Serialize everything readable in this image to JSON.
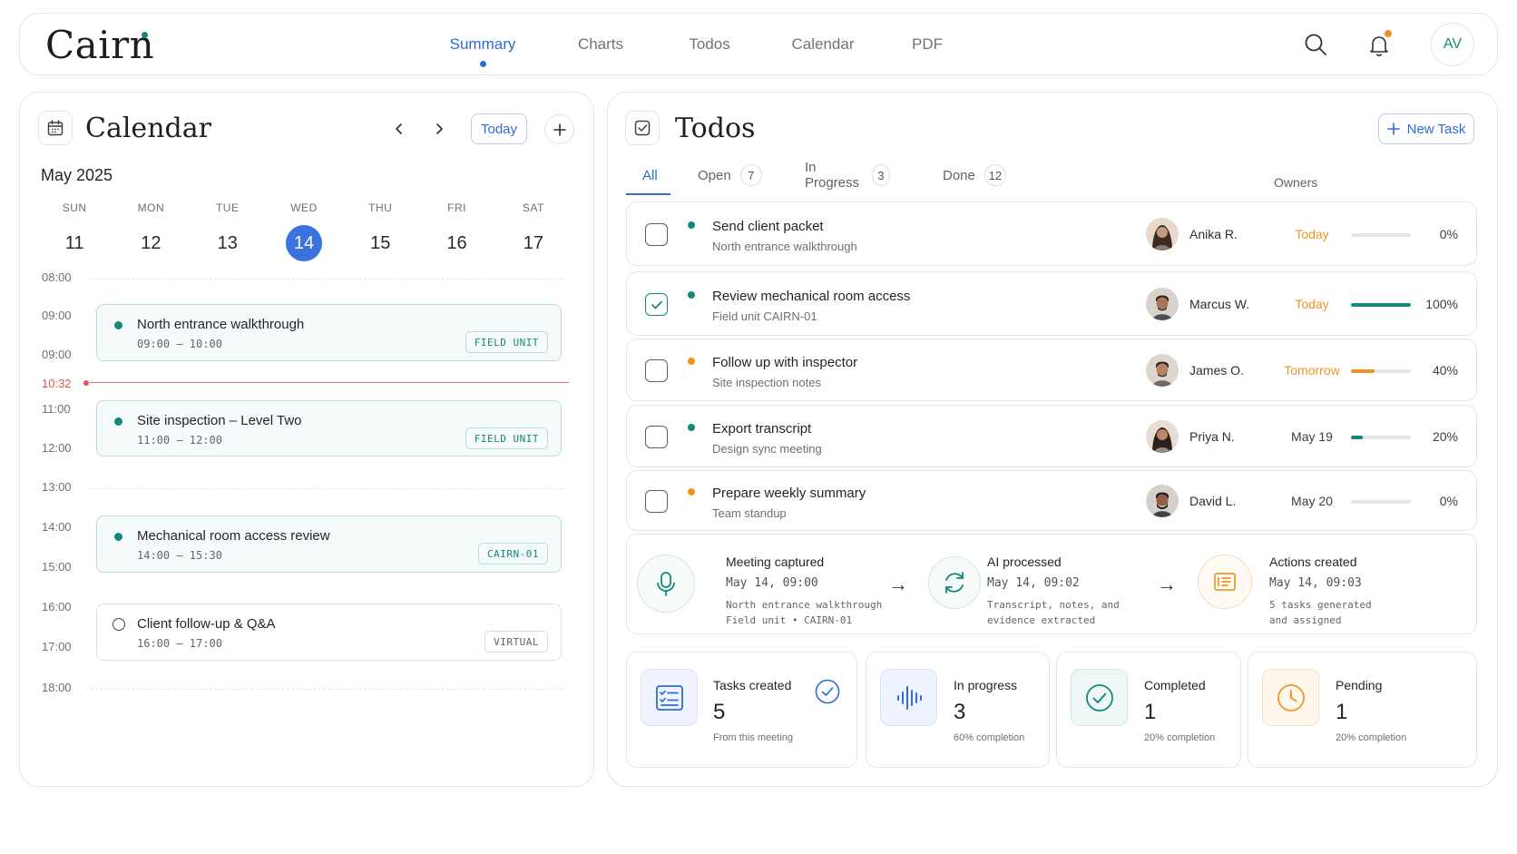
{
  "app": {
    "name": "Cairn"
  },
  "nav": {
    "items": [
      "Summary",
      "Charts",
      "Todos",
      "Calendar",
      "PDF"
    ],
    "active": "Summary"
  },
  "user": {
    "initials": "AV"
  },
  "icons": {
    "search": "search-icon",
    "bell": "bell-icon",
    "calendar": "calendar-icon",
    "todos": "checkbox-icon"
  },
  "calendar": {
    "title": "Calendar",
    "today_label": "Today",
    "month": "May 2025",
    "days": [
      {
        "name": "SUN",
        "num": "11"
      },
      {
        "name": "MON",
        "num": "12"
      },
      {
        "name": "TUE",
        "num": "13"
      },
      {
        "name": "WED",
        "num": "14",
        "selected": true
      },
      {
        "name": "THU",
        "num": "15"
      },
      {
        "name": "FRI",
        "num": "16"
      },
      {
        "name": "SAT",
        "num": "17"
      }
    ],
    "times": [
      "08:00",
      "09:00",
      "09:00",
      "11:00",
      "12:00",
      "13:00",
      "14:00",
      "15:00",
      "16:00",
      "17:00",
      "18:00"
    ],
    "now": "10:32",
    "events": [
      {
        "title": "North entrance walkthrough",
        "time": "09:00 – 10:00",
        "tag": "FIELD UNIT"
      },
      {
        "title": "Site inspection – Level Two",
        "time": "11:00 – 12:00",
        "tag": "FIELD UNIT"
      },
      {
        "title": "Mechanical room access review",
        "time": "14:00 – 15:30",
        "tag": "CAIRN-01"
      },
      {
        "title": "Client follow-up & Q&A",
        "time": "16:00 – 17:00",
        "tag": "VIRTUAL"
      }
    ]
  },
  "todos": {
    "title": "Todos",
    "new_task_label": "New Task",
    "tabs": [
      {
        "label": "All",
        "count": ""
      },
      {
        "label": "Open",
        "count": "7"
      },
      {
        "label": "In Progress",
        "count": "3"
      },
      {
        "label": "Done",
        "count": "12"
      }
    ],
    "owners_label": "Owners",
    "items": [
      {
        "title": "Send client packet",
        "subtitle": "North entrance walkthrough",
        "owner": "Anika R.",
        "due": "Today",
        "progress": "0%",
        "progress_value": 0,
        "checked": false,
        "priority_color": "#13897a",
        "due_color": "#ef9528",
        "bar_color": "#13897a"
      },
      {
        "title": "Review mechanical room access",
        "subtitle": "Field unit CAIRN-01",
        "owner": "Marcus W.",
        "due": "Today",
        "progress": "100%",
        "progress_value": 100,
        "checked": true,
        "priority_color": "#13897a",
        "due_color": "#ef9528",
        "bar_color": "#13897a"
      },
      {
        "title": "Follow up with inspector",
        "subtitle": "Site inspection notes",
        "owner": "James O.",
        "due": "Tomorrow",
        "progress": "40%",
        "progress_value": 40,
        "checked": false,
        "priority_color": "#f1921e",
        "due_color": "#ef9528",
        "bar_color": "#f1921e"
      },
      {
        "title": "Export transcript",
        "subtitle": "Design sync meeting",
        "owner": "Priya N.",
        "due": "May 19",
        "progress": "20%",
        "progress_value": 20,
        "checked": false,
        "priority_color": "#13897a",
        "due_color": "#3b4046",
        "bar_color": "#13897a"
      },
      {
        "title": "Prepare weekly summary",
        "subtitle": "Team standup",
        "owner": "David L.",
        "due": "May 20",
        "progress": "0%",
        "progress_value": 0,
        "checked": false,
        "priority_color": "#f1921e",
        "due_color": "#3b4046",
        "bar_color": "#13897a"
      }
    ]
  },
  "pipeline": [
    {
      "title": "Meeting captured",
      "time": "May 14, 09:00",
      "note1": "North entrance walkthrough",
      "note2": "Field unit • CAIRN-01",
      "icon": "microphone-icon"
    },
    {
      "title": "AI processed",
      "time": "May 14, 09:02",
      "note1": "Transcript, notes, and",
      "note2": "evidence extracted",
      "icon": "refresh-icon"
    },
    {
      "title": "Actions created",
      "time": "May 14, 09:03",
      "note1": "5 tasks generated",
      "note2": "and assigned",
      "icon": "list-icon"
    }
  ],
  "stats": [
    {
      "label": "Tasks created",
      "value": "5",
      "note": "From this meeting",
      "icon": "checklist-icon",
      "color": "#2f6bd8"
    },
    {
      "label": "In progress",
      "value": "3",
      "note": "60% completion",
      "icon": "waveform-icon",
      "color": "#2f6bd8"
    },
    {
      "label": "Completed",
      "value": "1",
      "note": "20% completion",
      "icon": "check-circle-icon",
      "color": "#13897a"
    },
    {
      "label": "Pending",
      "value": "1",
      "note": "20% completion",
      "icon": "clock-icon",
      "color": "#ef9528"
    }
  ]
}
